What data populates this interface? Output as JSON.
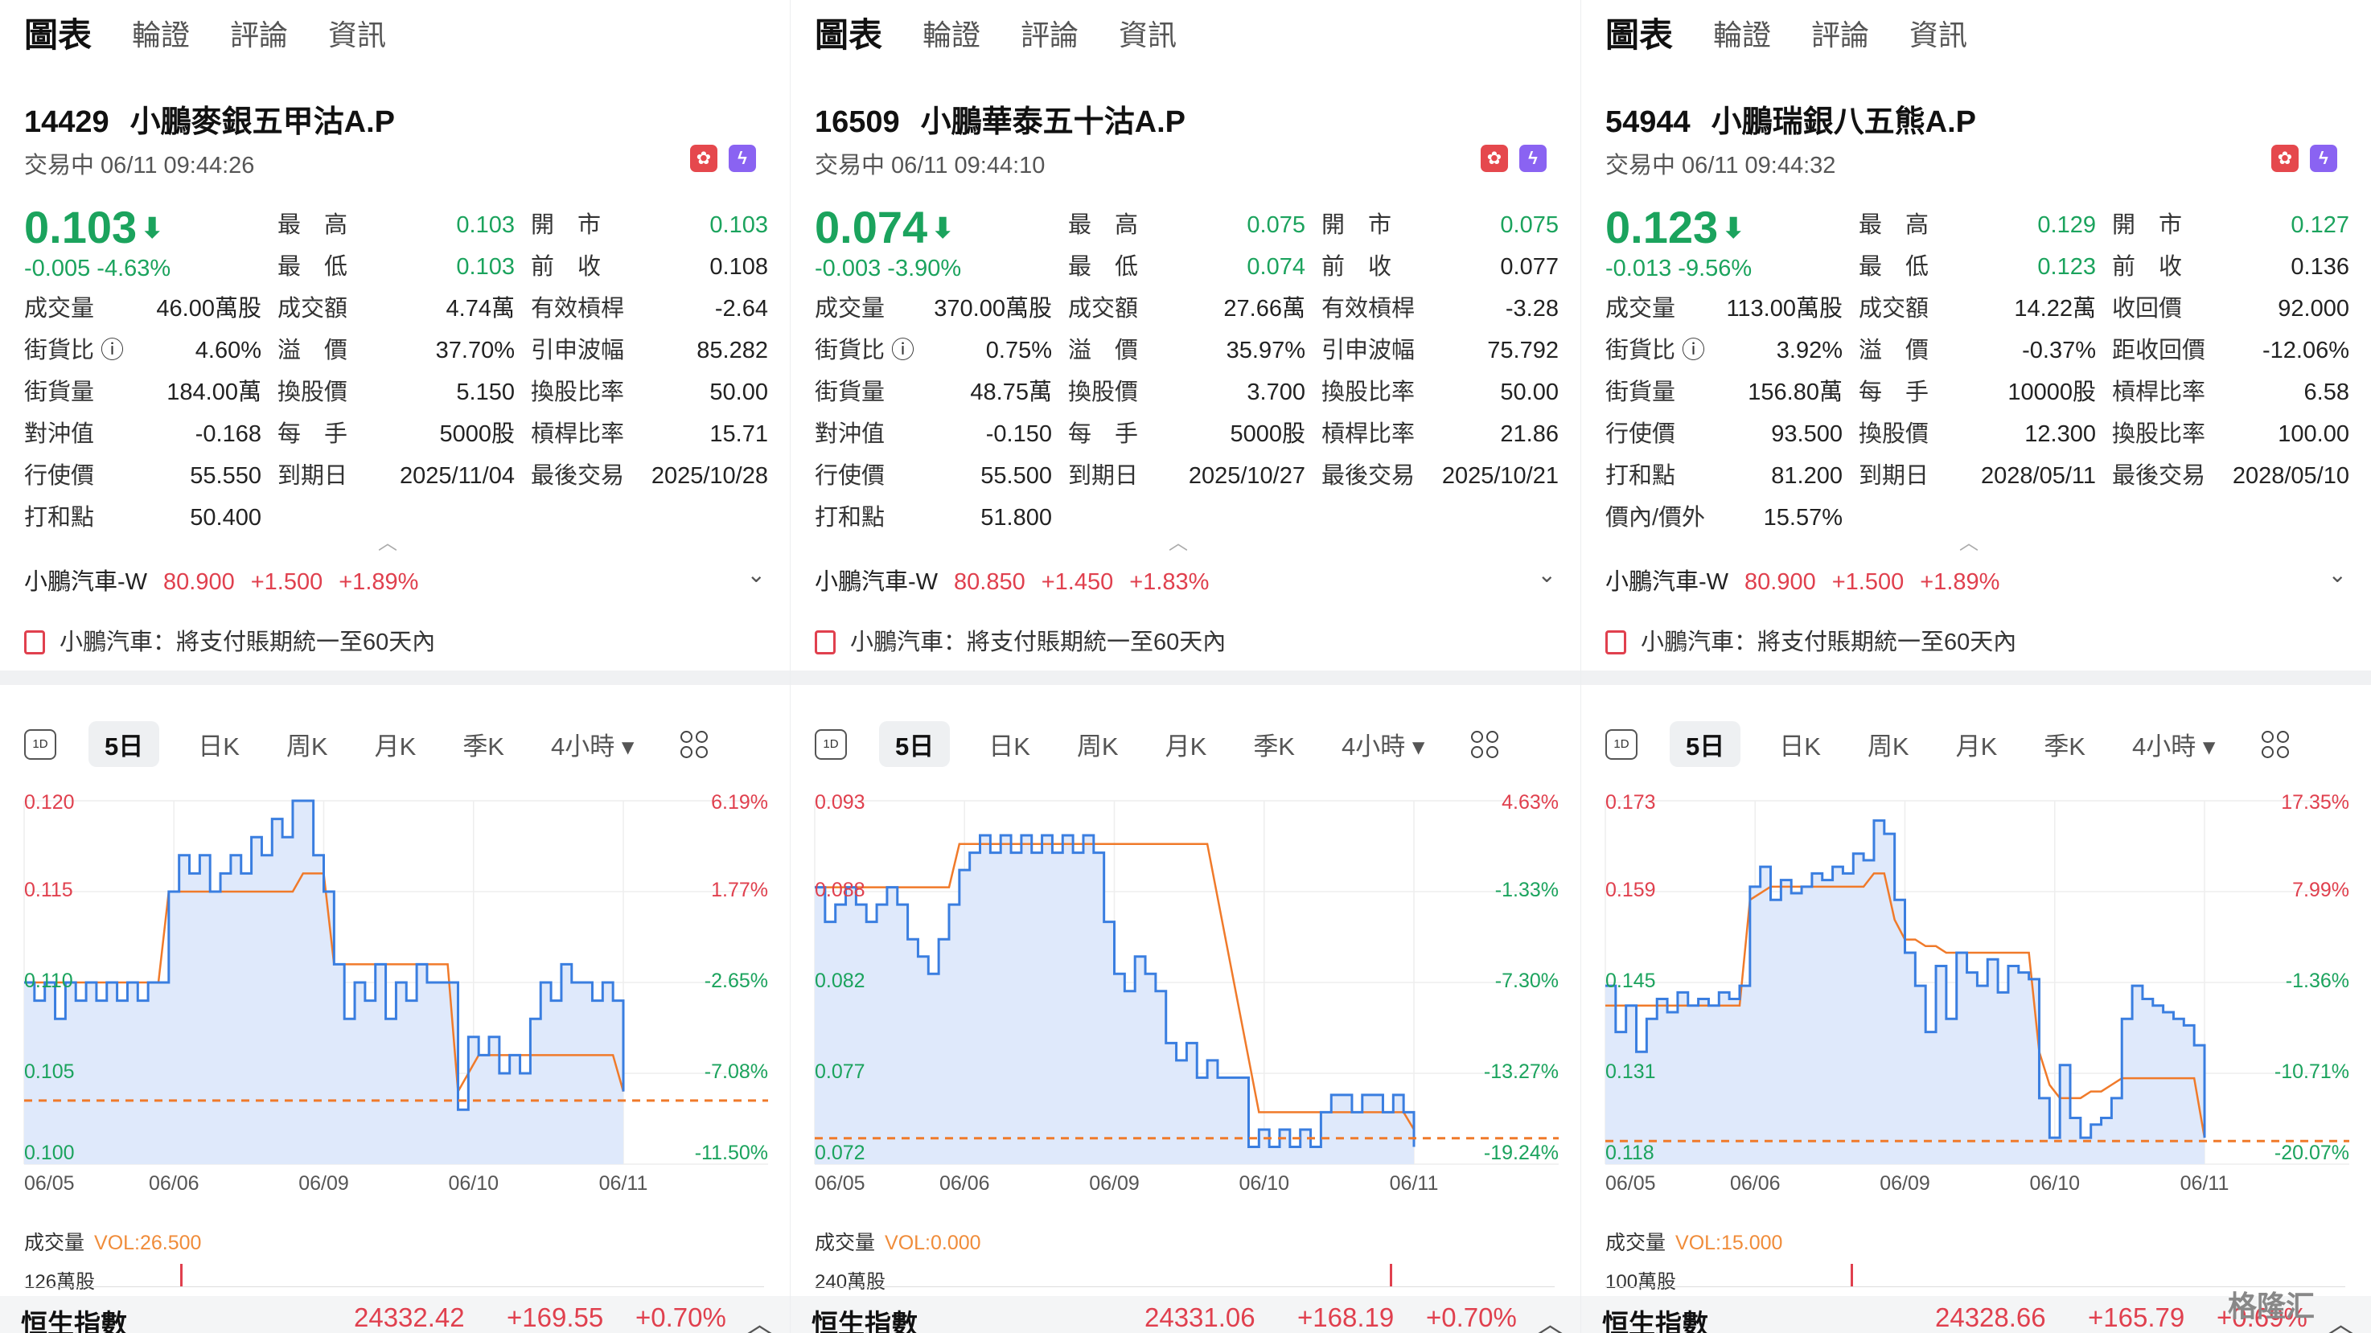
{
  "tabs": [
    "圖表",
    "輪證",
    "評論",
    "資訊"
  ],
  "chart_tabs": [
    "5日",
    "日K",
    "周K",
    "月K",
    "季K",
    "4小時 ▾"
  ],
  "panels": [
    {
      "code": "14429",
      "name": "小鵬麥銀五甲沽A.P",
      "status": "交易中 06/11 09:44:26",
      "price": "0.103",
      "change": "-0.005  -4.63%",
      "stats": [
        [
          [
            "最　高",
            "0.103",
            "green"
          ],
          [
            "開　市",
            "0.103",
            "green"
          ]
        ],
        [
          [
            "最　低",
            "0.103",
            "green"
          ],
          [
            "前　收",
            "0.108",
            ""
          ]
        ],
        [
          [
            "成交量",
            "46.00萬股",
            ""
          ],
          [
            "成交額",
            "4.74萬",
            ""
          ],
          [
            "有效槓桿",
            "-2.64",
            ""
          ]
        ],
        [
          [
            "街貨比 ⓘ",
            "4.60%",
            ""
          ],
          [
            "溢　價",
            "37.70%",
            ""
          ],
          [
            "引申波幅",
            "85.282",
            ""
          ]
        ],
        [
          [
            "街貨量",
            "184.00萬",
            ""
          ],
          [
            "換股價",
            "5.150",
            ""
          ],
          [
            "換股比率",
            "50.00",
            ""
          ]
        ],
        [
          [
            "對沖值",
            "-0.168",
            ""
          ],
          [
            "每　手",
            "5000股",
            ""
          ],
          [
            "槓桿比率",
            "15.71",
            ""
          ]
        ],
        [
          [
            "行使價",
            "55.550",
            ""
          ],
          [
            "到期日",
            "2025/11/04",
            ""
          ],
          [
            "最後交易",
            "2025/10/28",
            ""
          ]
        ],
        [
          [
            "打和點",
            "50.400",
            ""
          ]
        ]
      ],
      "underlying": {
        "name": "小鵬汽車-W",
        "price": "80.900",
        "chg": "+1.500",
        "pct": "+1.89%"
      },
      "news": "小鵬汽車：將支付賬期統一至60天內",
      "chart": {
        "y_left": [
          "0.120",
          "0.115",
          "0.110",
          "0.105",
          "0.100"
        ],
        "y_right": [
          "6.19%",
          "1.77%",
          "-2.65%",
          "-7.08%",
          "-11.50%"
        ],
        "ylim": [
          0.1,
          0.12
        ],
        "ref": 0.1035,
        "dates": [
          "06/05",
          "06/06",
          "06/09",
          "06/10",
          "06/11"
        ],
        "price": [
          0.11,
          0.109,
          0.11,
          0.108,
          0.11,
          0.109,
          0.11,
          0.109,
          0.11,
          0.109,
          0.11,
          0.109,
          0.11,
          0.11,
          0.115,
          0.117,
          0.116,
          0.117,
          0.115,
          0.116,
          0.117,
          0.116,
          0.118,
          0.117,
          0.119,
          0.118,
          0.12,
          0.12,
          0.117,
          0.115,
          0.111,
          0.108,
          0.11,
          0.109,
          0.111,
          0.108,
          0.11,
          0.109,
          0.111,
          0.11,
          0.11,
          0.11,
          0.103,
          0.107,
          0.106,
          0.107,
          0.105,
          0.106,
          0.105,
          0.108,
          0.11,
          0.109,
          0.111,
          0.11,
          0.11,
          0.109,
          0.11,
          0.109,
          0.104
        ],
        "avg": [
          0.11,
          0.11,
          0.11,
          0.11,
          0.11,
          0.11,
          0.11,
          0.11,
          0.11,
          0.11,
          0.11,
          0.11,
          0.11,
          0.11,
          0.115,
          0.115,
          0.115,
          0.115,
          0.115,
          0.115,
          0.115,
          0.115,
          0.115,
          0.115,
          0.115,
          0.115,
          0.115,
          0.116,
          0.116,
          0.116,
          0.111,
          0.111,
          0.111,
          0.111,
          0.111,
          0.111,
          0.111,
          0.111,
          0.111,
          0.111,
          0.111,
          0.111,
          0.104,
          0.105,
          0.106,
          0.106,
          0.106,
          0.106,
          0.106,
          0.106,
          0.106,
          0.106,
          0.106,
          0.106,
          0.106,
          0.106,
          0.106,
          0.106,
          0.104
        ],
        "vol_label": "VOL:26.500",
        "vol_max": "126萬股",
        "vol_bar_at": 0.26
      },
      "index": {
        "name": "恒生指數",
        "value": "24332.42",
        "chg": "+169.55",
        "pct": "+0.70%"
      }
    },
    {
      "code": "16509",
      "name": "小鵬華泰五十沽A.P",
      "status": "交易中 06/11 09:44:10",
      "price": "0.074",
      "change": "-0.003  -3.90%",
      "stats": [
        [
          [
            "最　高",
            "0.075",
            "green"
          ],
          [
            "開　市",
            "0.075",
            "green"
          ]
        ],
        [
          [
            "最　低",
            "0.074",
            "green"
          ],
          [
            "前　收",
            "0.077",
            ""
          ]
        ],
        [
          [
            "成交量",
            "370.00萬股",
            ""
          ],
          [
            "成交額",
            "27.66萬",
            ""
          ],
          [
            "有效槓桿",
            "-3.28",
            ""
          ]
        ],
        [
          [
            "街貨比 ⓘ",
            "0.75%",
            ""
          ],
          [
            "溢　價",
            "35.97%",
            ""
          ],
          [
            "引申波幅",
            "75.792",
            ""
          ]
        ],
        [
          [
            "街貨量",
            "48.75萬",
            ""
          ],
          [
            "換股價",
            "3.700",
            ""
          ],
          [
            "換股比率",
            "50.00",
            ""
          ]
        ],
        [
          [
            "對沖值",
            "-0.150",
            ""
          ],
          [
            "每　手",
            "5000股",
            ""
          ],
          [
            "槓桿比率",
            "21.86",
            ""
          ]
        ],
        [
          [
            "行使價",
            "55.500",
            ""
          ],
          [
            "到期日",
            "2025/10/27",
            ""
          ],
          [
            "最後交易",
            "2025/10/21",
            ""
          ]
        ],
        [
          [
            "打和點",
            "51.800",
            ""
          ]
        ]
      ],
      "underlying": {
        "name": "小鵬汽車-W",
        "price": "80.850",
        "chg": "+1.450",
        "pct": "+1.83%"
      },
      "news": "小鵬汽車：將支付賬期統一至60天內",
      "chart": {
        "y_left": [
          "0.093",
          "0.088",
          "0.082",
          "0.077",
          "0.072"
        ],
        "y_right": [
          "4.63%",
          "-1.33%",
          "-7.30%",
          "-13.27%",
          "-19.24%"
        ],
        "ylim": [
          0.072,
          0.093
        ],
        "ref": 0.0735,
        "dates": [
          "06/05",
          "06/06",
          "06/09",
          "06/10",
          "06/11"
        ],
        "price": [
          0.088,
          0.086,
          0.087,
          0.088,
          0.087,
          0.086,
          0.087,
          0.088,
          0.087,
          0.085,
          0.084,
          0.083,
          0.085,
          0.087,
          0.089,
          0.09,
          0.091,
          0.09,
          0.091,
          0.09,
          0.091,
          0.09,
          0.091,
          0.09,
          0.091,
          0.09,
          0.091,
          0.09,
          0.086,
          0.083,
          0.082,
          0.084,
          0.083,
          0.082,
          0.079,
          0.078,
          0.079,
          0.077,
          0.078,
          0.077,
          0.077,
          0.077,
          0.073,
          0.074,
          0.073,
          0.074,
          0.073,
          0.074,
          0.073,
          0.075,
          0.076,
          0.076,
          0.075,
          0.076,
          0.076,
          0.075,
          0.076,
          0.075,
          0.073
        ],
        "avg": [
          0.088,
          0.088,
          0.088,
          0.088,
          0.088,
          0.088,
          0.088,
          0.088,
          0.088,
          0.088,
          0.088,
          0.088,
          0.088,
          0.088,
          0.0905,
          0.0905,
          0.0905,
          0.0905,
          0.0905,
          0.0905,
          0.0905,
          0.0905,
          0.0905,
          0.0905,
          0.0905,
          0.0905,
          0.0905,
          0.0905,
          0.0905,
          0.0905,
          0.0905,
          0.0905,
          0.0905,
          0.0905,
          0.0905,
          0.0905,
          0.0905,
          0.0905,
          0.0905,
          0.0905,
          0.0905,
          0.0905,
          0.0735,
          0.075,
          0.075,
          0.075,
          0.075,
          0.075,
          0.075,
          0.075,
          0.075,
          0.075,
          0.075,
          0.075,
          0.075,
          0.075,
          0.075,
          0.075,
          0.074
        ],
        "avg_gap": [
          28,
          42
        ],
        "vol_label": "VOL:0.000",
        "vol_max": "240萬股",
        "vol_bar_at": 0.96
      },
      "index": {
        "name": "恒生指數",
        "value": "24331.06",
        "chg": "+168.19",
        "pct": "+0.70%"
      }
    },
    {
      "code": "54944",
      "name": "小鵬瑞銀八五熊A.P",
      "status": "交易中 06/11 09:44:32",
      "price": "0.123",
      "change": "-0.013  -9.56%",
      "stats": [
        [
          [
            "最　高",
            "0.129",
            "green"
          ],
          [
            "開　市",
            "0.127",
            "green"
          ]
        ],
        [
          [
            "最　低",
            "0.123",
            "green"
          ],
          [
            "前　收",
            "0.136",
            ""
          ]
        ],
        [
          [
            "成交量",
            "113.00萬股",
            ""
          ],
          [
            "成交額",
            "14.22萬",
            ""
          ],
          [
            "收回價",
            "92.000",
            ""
          ]
        ],
        [
          [
            "街貨比 ⓘ",
            "3.92%",
            ""
          ],
          [
            "溢　價",
            "-0.37%",
            ""
          ],
          [
            "距收回價",
            "-12.06%",
            ""
          ]
        ],
        [
          [
            "街貨量",
            "156.80萬",
            ""
          ],
          [
            "每　手",
            "10000股",
            ""
          ],
          [
            "槓桿比率",
            "6.58",
            ""
          ]
        ],
        [
          [
            "行使價",
            "93.500",
            ""
          ],
          [
            "換股價",
            "12.300",
            ""
          ],
          [
            "換股比率",
            "100.00",
            ""
          ]
        ],
        [
          [
            "打和點",
            "81.200",
            ""
          ],
          [
            "到期日",
            "2028/05/11",
            ""
          ],
          [
            "最後交易",
            "2028/05/10",
            ""
          ]
        ],
        [
          [
            "價內/價外",
            "15.57%",
            ""
          ]
        ]
      ],
      "underlying": {
        "name": "小鵬汽車-W",
        "price": "80.900",
        "chg": "+1.500",
        "pct": "+1.89%"
      },
      "news": "小鵬汽車：將支付賬期統一至60天內",
      "chart": {
        "y_left": [
          "0.173",
          "0.159",
          "0.145",
          "0.131",
          "0.118"
        ],
        "y_right": [
          "17.35%",
          "7.99%",
          "-1.36%",
          "-10.71%",
          "-20.07%"
        ],
        "ylim": [
          0.118,
          0.173
        ],
        "ref": 0.1215,
        "dates": [
          "06/05",
          "06/06",
          "06/09",
          "06/10",
          "06/11"
        ],
        "price": [
          0.145,
          0.138,
          0.142,
          0.135,
          0.14,
          0.143,
          0.141,
          0.144,
          0.142,
          0.143,
          0.142,
          0.144,
          0.143,
          0.145,
          0.16,
          0.163,
          0.158,
          0.161,
          0.159,
          0.16,
          0.162,
          0.161,
          0.163,
          0.162,
          0.165,
          0.164,
          0.17,
          0.168,
          0.158,
          0.15,
          0.145,
          0.138,
          0.148,
          0.14,
          0.15,
          0.147,
          0.145,
          0.149,
          0.144,
          0.148,
          0.147,
          0.146,
          0.128,
          0.122,
          0.133,
          0.125,
          0.122,
          0.124,
          0.125,
          0.128,
          0.14,
          0.145,
          0.143,
          0.142,
          0.141,
          0.14,
          0.139,
          0.136,
          0.122
        ],
        "avg": [
          0.142,
          0.142,
          0.142,
          0.142,
          0.142,
          0.142,
          0.142,
          0.142,
          0.142,
          0.142,
          0.142,
          0.142,
          0.142,
          0.142,
          0.158,
          0.159,
          0.16,
          0.16,
          0.16,
          0.16,
          0.16,
          0.16,
          0.16,
          0.16,
          0.16,
          0.16,
          0.162,
          0.162,
          0.155,
          0.152,
          0.152,
          0.151,
          0.151,
          0.15,
          0.15,
          0.15,
          0.15,
          0.15,
          0.15,
          0.15,
          0.15,
          0.15,
          0.135,
          0.13,
          0.128,
          0.128,
          0.128,
          0.129,
          0.129,
          0.13,
          0.131,
          0.131,
          0.131,
          0.131,
          0.131,
          0.131,
          0.131,
          0.131,
          0.122
        ],
        "vol_label": "VOL:15.000",
        "vol_max": "100萬股",
        "vol_bar_at": 0.41
      },
      "index": {
        "name": "恒生指數",
        "value": "24328.66",
        "chg": "+165.79",
        "pct": "+0.69%"
      }
    }
  ],
  "labels": {
    "volume": "成交量",
    "watermark": "格隆汇"
  },
  "colors": {
    "green": "#1ba35d",
    "red": "#e0404e",
    "orange": "#f07a2a",
    "blue": "#3a7ee0",
    "fill": "#dfe9fb"
  }
}
